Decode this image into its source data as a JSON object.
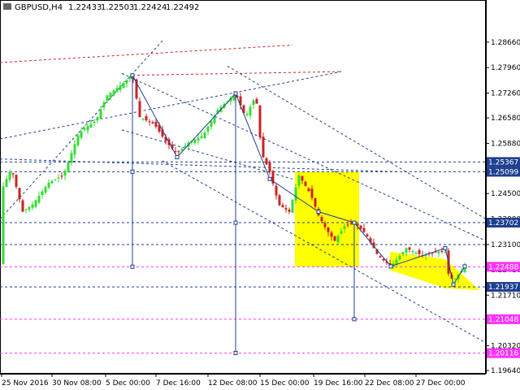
{
  "chart_data": {
    "type": "candlestick",
    "title": "GBPUSD,H4",
    "ohlc": [
      "1.22433",
      "1.22503",
      "1.22424",
      "1.22492"
    ],
    "ylim": [
      1.1964,
      1.2917
    ],
    "y_ticks": [
      "1.28660",
      "1.27960",
      "1.27260",
      "1.26580",
      "1.25880",
      "1.25180",
      "1.24500",
      "1.23800",
      "1.23100",
      "1.22410",
      "1.21710",
      "1.21020",
      "1.20320",
      "1.19640"
    ],
    "x_ticks": [
      "25 Nov 2016",
      "30 Nov 08:00",
      "5 Dec 00:00",
      "7 Dec 16:00",
      "12 Dec 08:00",
      "15 Dec 00:00",
      "19 Dec 16:00",
      "22 Dec 08:00",
      "27 Dec 00:00"
    ],
    "price_levels": [
      {
        "label": "1.25367",
        "value": 1.25367,
        "color": "#1f3f8f"
      },
      {
        "label": "1.25099",
        "value": 1.25099,
        "color": "#1f3f8f"
      },
      {
        "label": "1.23702",
        "value": 1.23702,
        "color": "#1f3f8f"
      },
      {
        "label": "1.22488",
        "value": 1.22488,
        "color": "#ff33ff"
      },
      {
        "label": "1.21937",
        "value": 1.21937,
        "color": "#1f3f8f"
      },
      {
        "label": "1.21048",
        "value": 1.21048,
        "color": "#ff33ff"
      },
      {
        "label": "1.20116",
        "value": 1.20116,
        "color": "#ff33ff"
      }
    ],
    "grid": false,
    "colors": {
      "bull": "#33dd33",
      "bear": "#cc2222",
      "structure": "#1f3f8f",
      "target": "#ff33ff",
      "zone": "#ffff00"
    }
  }
}
